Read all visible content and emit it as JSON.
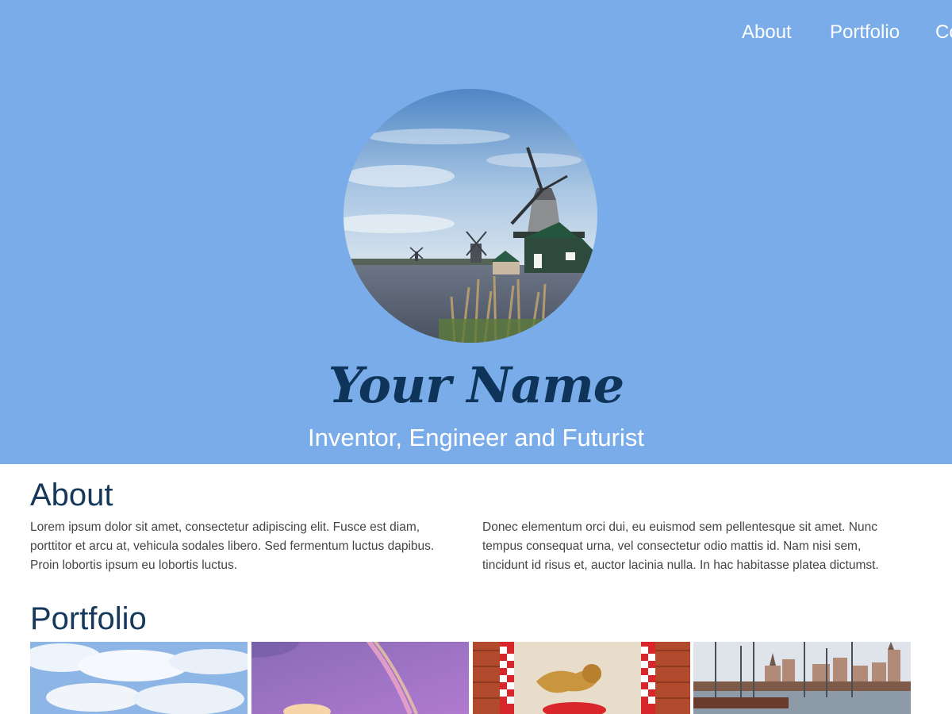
{
  "nav": {
    "items": [
      {
        "label": "About"
      },
      {
        "label": "Portfolio"
      },
      {
        "label": "Contact"
      }
    ]
  },
  "hero": {
    "name": "Your Name",
    "tagline": "Inventor, Engineer and Futurist",
    "avatar_icon": "windmill-photo"
  },
  "about": {
    "title": "About",
    "col1": "Lorem ipsum dolor sit amet, consectetur adipiscing elit. Fusce est diam, porttitor et arcu at, vehicula sodales libero. Sed fermentum luctus dapibus. Proin lobortis ipsum eu lobortis luctus.",
    "col2": "Donec elementum orci dui, eu euismod sem pellentesque sit amet. Nunc tempus consequat urna, vel consectetur odio mattis id. Nam nisi sem, tincidunt id risus et, auctor lacinia nulla. In hac habitasse platea dictumst."
  },
  "portfolio": {
    "title": "Portfolio",
    "items": [
      {
        "icon": "sky-clouds-photo"
      },
      {
        "icon": "rainbow-photo"
      },
      {
        "icon": "lion-banner-photo"
      },
      {
        "icon": "harbor-city-photo"
      }
    ]
  },
  "colors": {
    "hero_background": "#79ace8",
    "name_color": "#0f3459",
    "heading_color": "#15385b",
    "nav_text": "#ffffff"
  }
}
